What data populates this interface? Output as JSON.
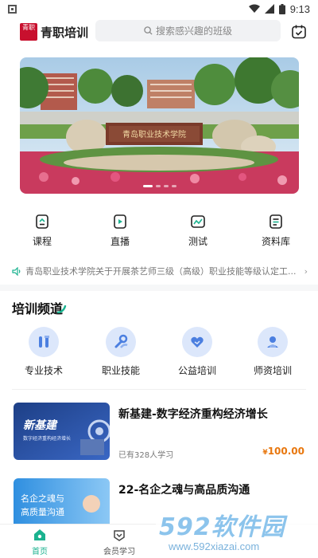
{
  "status_bar": {
    "time": "9:13"
  },
  "header": {
    "logo_mark": "青职",
    "app_name": "青职培训",
    "search_placeholder": "搜索感兴趣的班级"
  },
  "banner": {
    "sign_text": "青岛职业技术学院"
  },
  "quick_nav": [
    {
      "label": "课程",
      "icon": "course-icon"
    },
    {
      "label": "直播",
      "icon": "live-icon"
    },
    {
      "label": "测试",
      "icon": "test-icon"
    },
    {
      "label": "资料库",
      "icon": "library-icon"
    }
  ],
  "notice": {
    "text": "青岛职业技术学院关于开展茶艺师三级（高级）职业技能等级认定工..."
  },
  "section": {
    "title": "培训频道"
  },
  "channels": [
    {
      "label": "专业技术",
      "icon": "tools-icon"
    },
    {
      "label": "职业技能",
      "icon": "wrench-hand-icon"
    },
    {
      "label": "公益培训",
      "icon": "heart-hands-icon"
    },
    {
      "label": "师资培训",
      "icon": "teacher-icon"
    }
  ],
  "courses": [
    {
      "title": "新基建-数字经济重构经济增长",
      "learners": "已有328人学习",
      "price_currency": "¥",
      "price": "100.00",
      "thumb_title": "新基建",
      "thumb_subtitle": "数字经济重构经济增长"
    },
    {
      "title": "22-名企之魂与高品质沟通",
      "thumb_line1": "名企之魂与",
      "thumb_line2": "高质量沟通"
    }
  ],
  "tabs": [
    {
      "label": "首页",
      "icon": "home-icon",
      "active": true
    },
    {
      "label": "会员学习",
      "icon": "member-icon",
      "active": false
    }
  ],
  "watermark": {
    "logo": "592软件园",
    "url": "www.592xiazai.com"
  },
  "colors": {
    "accent": "#1bb28f",
    "price": "#e8770e",
    "brand_red": "#c8102e",
    "channel_bg": "#dce7fb"
  }
}
